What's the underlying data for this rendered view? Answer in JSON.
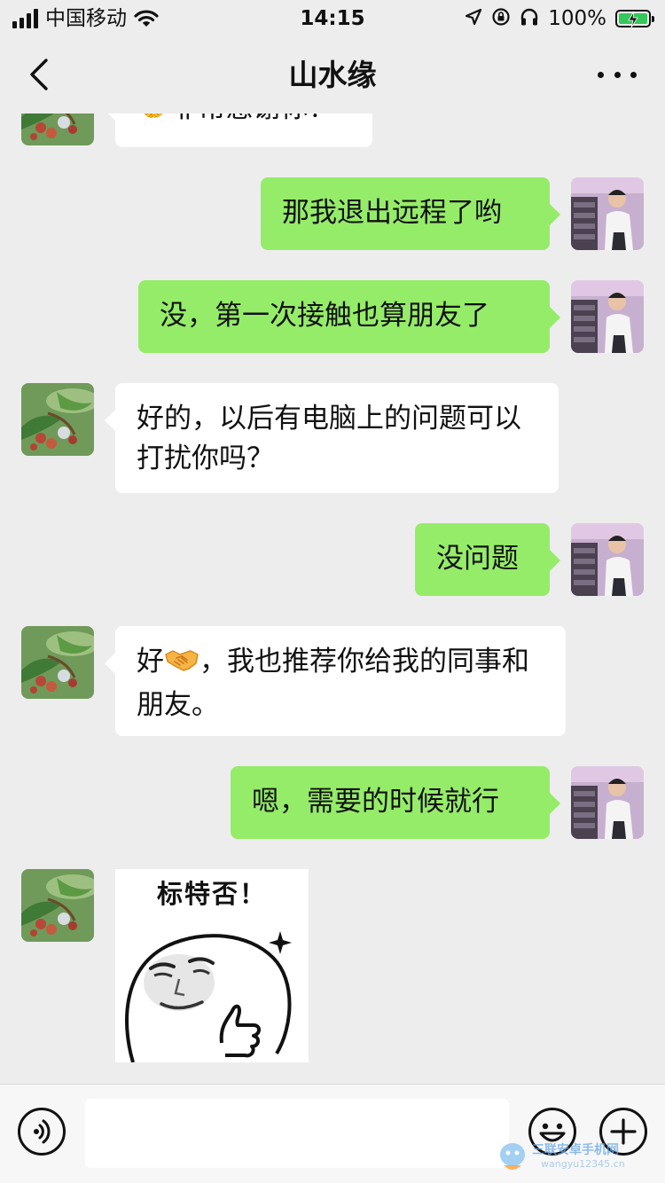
{
  "status_bar": {
    "carrier": "中国移动",
    "time": "14:15",
    "battery_percent": "100%",
    "battery_level": 1.0
  },
  "nav": {
    "title": "山水缘",
    "back_icon": "chevron-left-icon",
    "more_icon": "more-dots-icon"
  },
  "messages": [
    {
      "side": "in",
      "text": "🤝非常感谢你！"
    },
    {
      "side": "out",
      "text": "那我退出远程了哟"
    },
    {
      "side": "out",
      "text": "没，第一次接触也算朋友了"
    },
    {
      "side": "in",
      "text": "好的，以后有电脑上的问题可以打扰你吗？"
    },
    {
      "side": "out",
      "text": "没问题"
    },
    {
      "side": "in",
      "text_before": "好",
      "emoji": "handshake-emoji",
      "text_after": "，我也推荐你给我的同事和朋友。"
    },
    {
      "side": "out",
      "text": "嗯，需要的时候就行"
    },
    {
      "side": "in",
      "type": "sticker",
      "sticker_text": "标特否！"
    }
  ],
  "input_bar": {
    "voice_icon": "voice-icon",
    "emoji_icon": "emoji-icon",
    "plus_icon": "plus-icon",
    "input_value": ""
  },
  "watermark": {
    "text": "三联安卓手机网",
    "sub": "wangyu12345.cn"
  },
  "colors": {
    "background": "#ededed",
    "incoming_bubble": "#ffffff",
    "outgoing_bubble": "#95ec69",
    "battery_fill": "#34c759"
  }
}
